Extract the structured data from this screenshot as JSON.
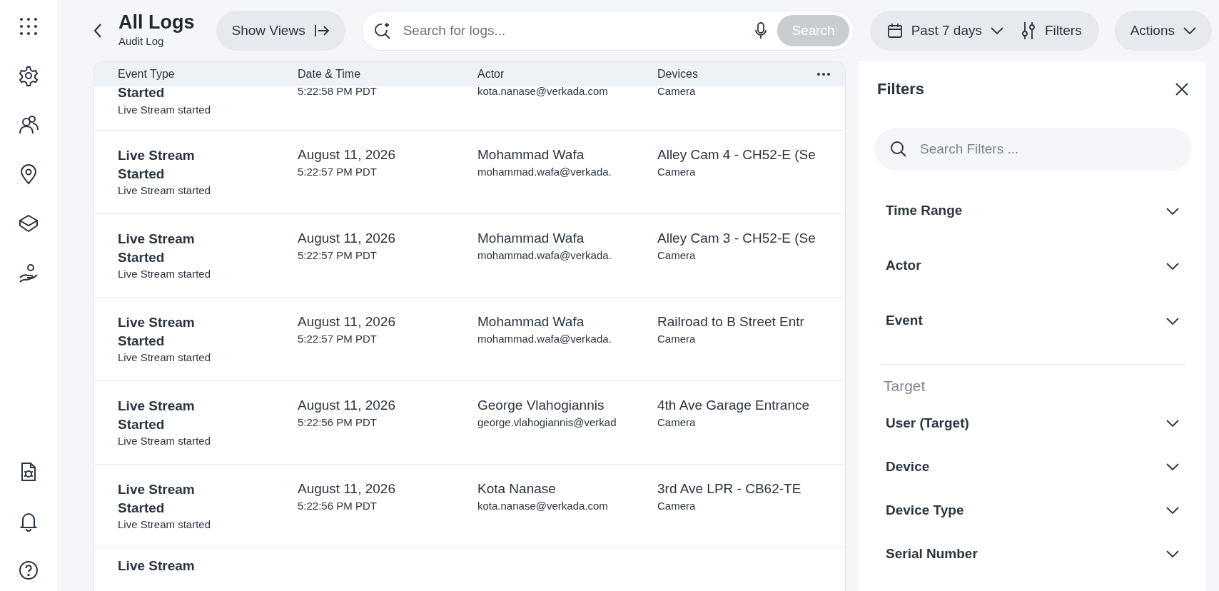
{
  "header": {
    "title": "All Logs",
    "subtitle": "Audit Log"
  },
  "show_views_button": "Show Views",
  "search": {
    "placeholder": "Search for logs...",
    "button": "Search",
    "button_disabled": true
  },
  "date_range": "Past 7 days",
  "filters_button": "Filters",
  "actions_button": "Actions",
  "table": {
    "columns": [
      "Event Type",
      "Date & Time",
      "Actor",
      "Devices"
    ],
    "rows": [
      {
        "event_title": "Started",
        "event_detail": "Live Stream started",
        "time": "5:22:58 PM PDT",
        "actor_email": "kota.nanase@verkada.com",
        "device_type": "Camera"
      },
      {
        "event_title": "Live Stream Started",
        "event_detail": "Live Stream started",
        "date": "August 11, 2026",
        "time": "5:22:57 PM PDT",
        "actor_name": "Mohammad Wafa",
        "actor_email": "mohammad.wafa@verkada.",
        "device_name": "Alley Cam 4 - CH52-E (Se",
        "device_type": "Camera"
      },
      {
        "event_title": "Live Stream Started",
        "event_detail": "Live Stream started",
        "date": "August 11, 2026",
        "time": "5:22:57 PM PDT",
        "actor_name": "Mohammad Wafa",
        "actor_email": "mohammad.wafa@verkada.",
        "device_name": "Alley Cam 3 - CH52-E (Se",
        "device_type": "Camera"
      },
      {
        "event_title": "Live Stream Started",
        "event_detail": "Live Stream started",
        "date": "August 11, 2026",
        "time": "5:22:57 PM PDT",
        "actor_name": "Mohammad Wafa",
        "actor_email": "mohammad.wafa@verkada.",
        "device_name": "Railroad to B Street Entr",
        "device_type": "Camera"
      },
      {
        "event_title": "Live Stream Started",
        "event_detail": "Live Stream started",
        "date": "August 11, 2026",
        "time": "5:22:56 PM PDT",
        "actor_name": "George Vlahogiannis",
        "actor_email": "george.vlahogiannis@verkad",
        "device_name": "4th Ave Garage Entrance",
        "device_type": "Camera"
      },
      {
        "event_title": "Live Stream Started",
        "event_detail": "Live Stream started",
        "date": "August 11, 2026",
        "time": "5:22:56 PM PDT",
        "actor_name": "Kota Nanase",
        "actor_email": "kota.nanase@verkada.com",
        "device_name": "3rd Ave LPR - CB62-TE",
        "device_type": "Camera"
      },
      {
        "event_title": "Live Stream"
      }
    ]
  },
  "filters_panel": {
    "title": "Filters",
    "search_placeholder": "Search Filters ...",
    "groups": [
      {
        "items": [
          "Time Range",
          "Actor",
          "Event"
        ]
      },
      {
        "heading": "Target",
        "items": [
          "User (Target)",
          "Device",
          "Device Type",
          "Serial Number"
        ]
      }
    ]
  }
}
